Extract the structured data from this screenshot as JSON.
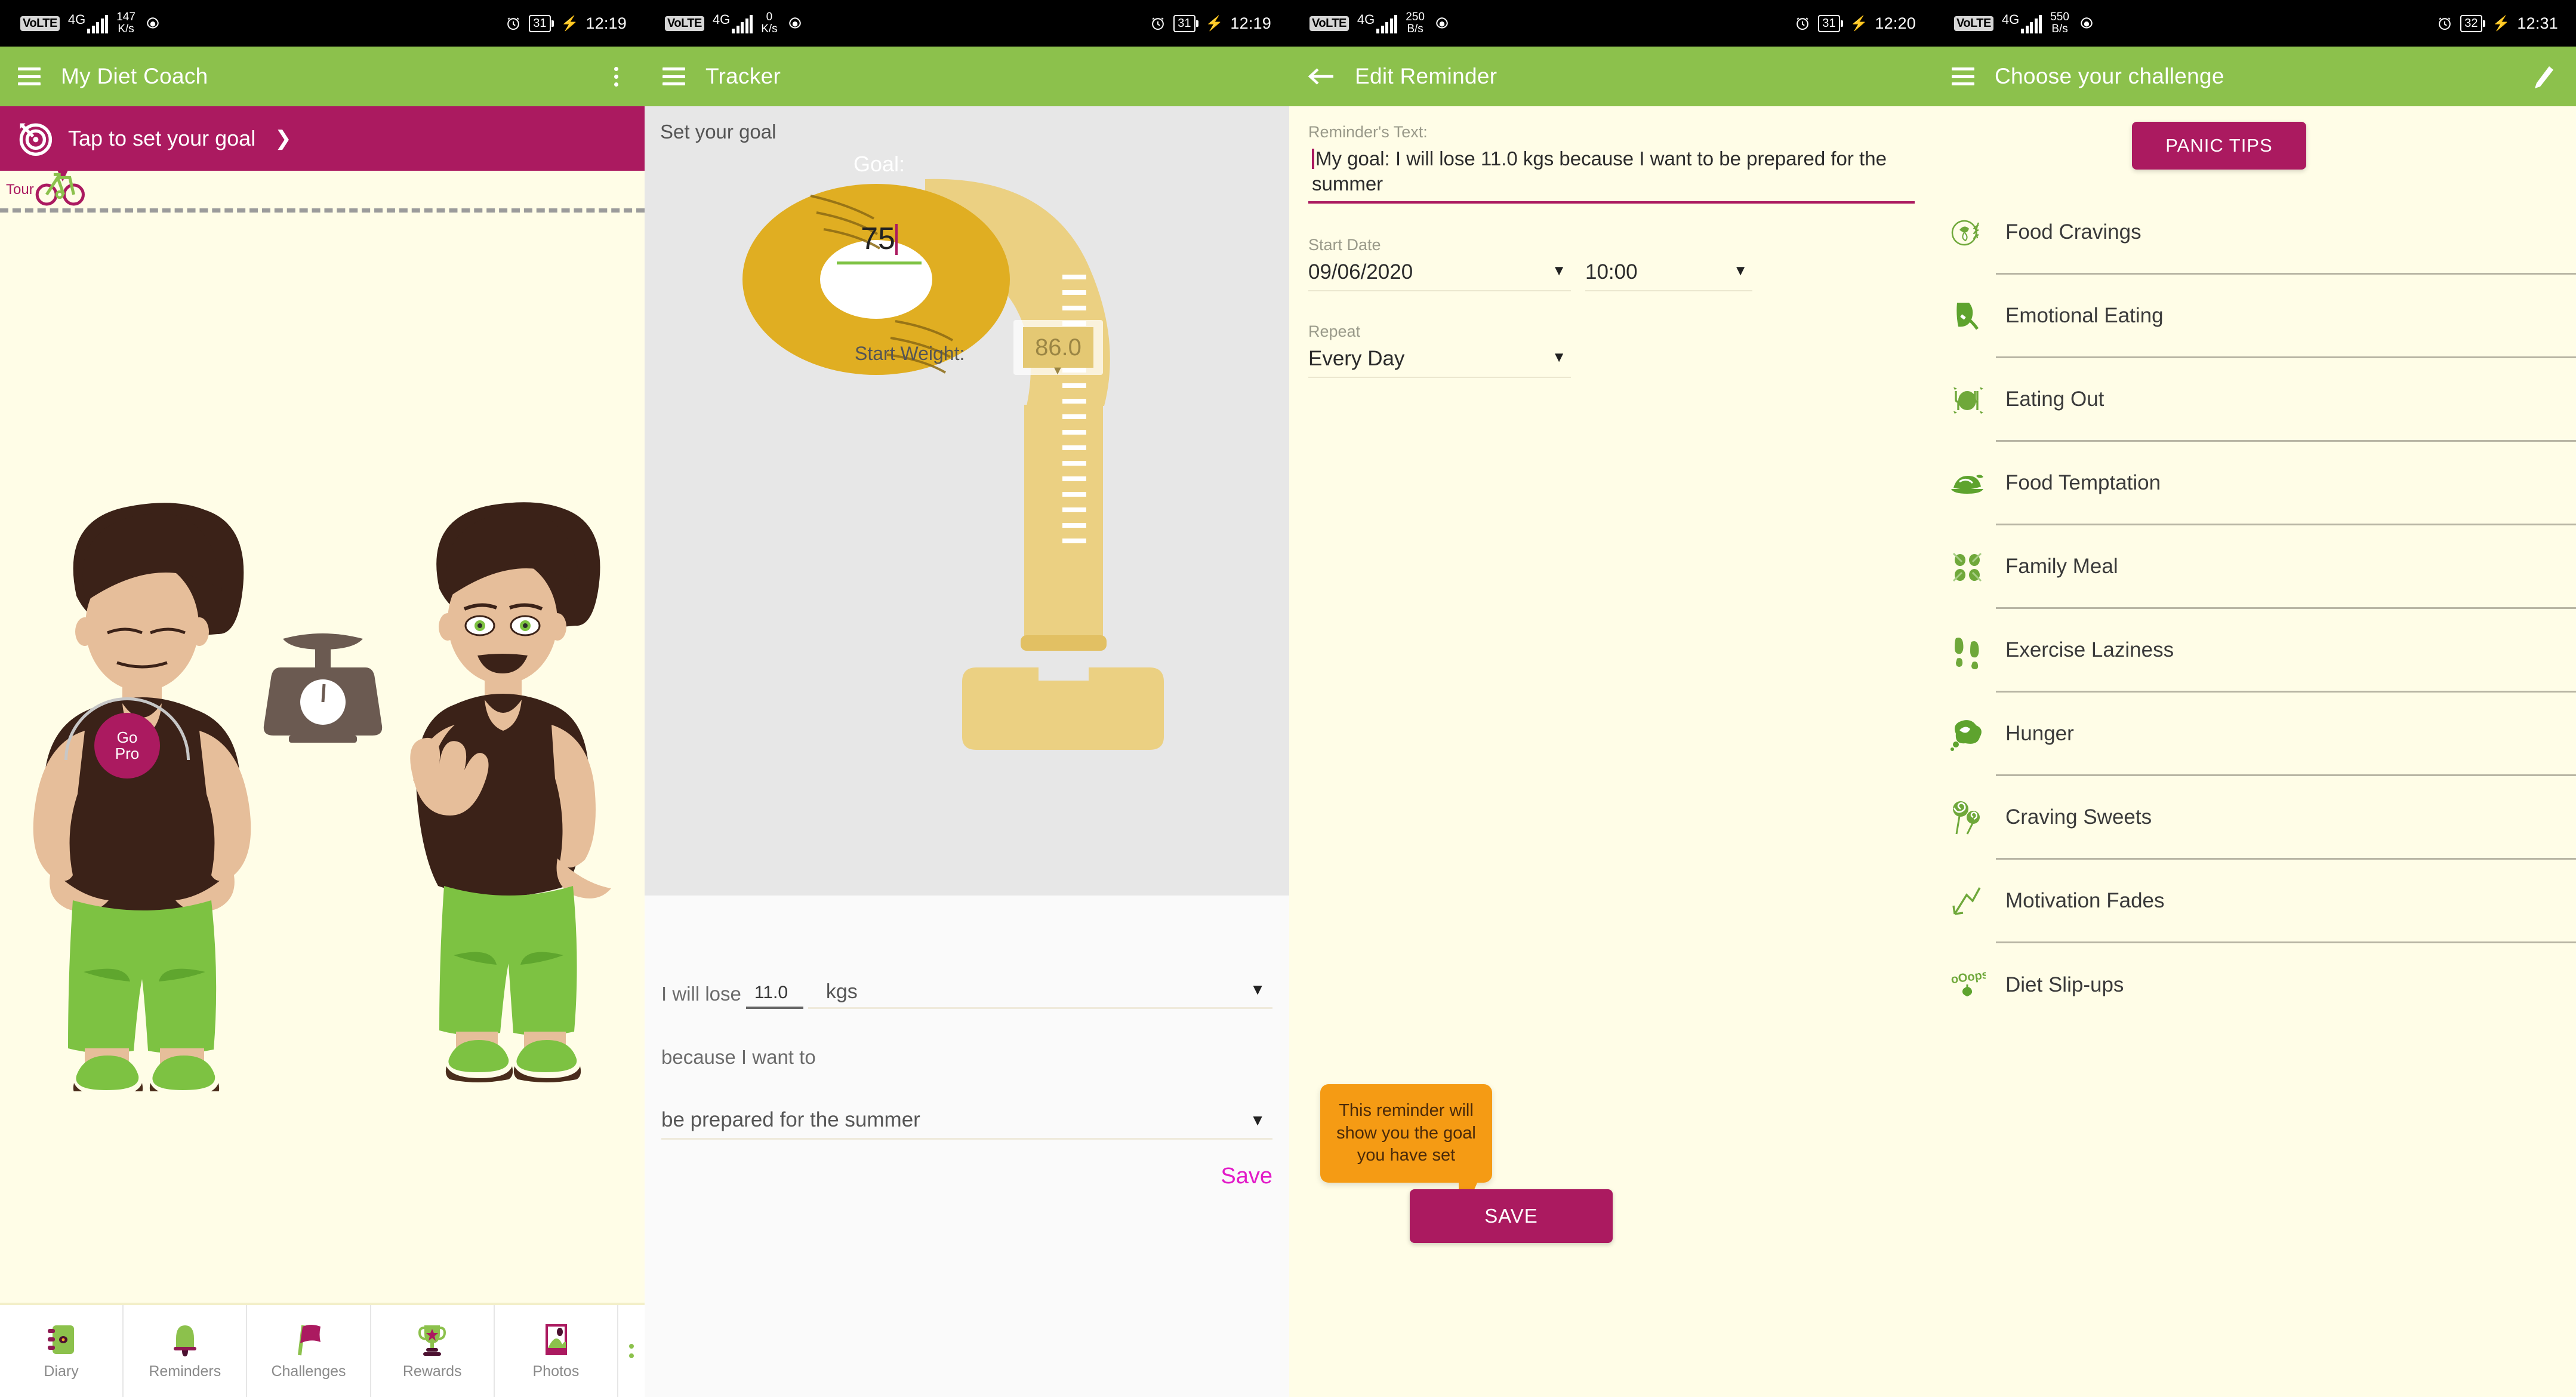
{
  "panels": [
    {
      "status": {
        "volte": "VoLTE",
        "network": "4G",
        "speed_value": "147",
        "speed_unit": "K/s",
        "battery": "31",
        "time": "12:19"
      },
      "appbar": {
        "title": "My Diet Coach",
        "menu_icon": "hamburger-icon",
        "overflow_icon": "kebab-menu-icon"
      },
      "goal_banner": {
        "text": "Tap to set your goal",
        "chevron": "❯",
        "icon": "target-icon"
      },
      "tour": {
        "label": "Tour",
        "icon": "bicycle-icon"
      },
      "go_pro": {
        "line1": "Go",
        "line2": "Pro"
      },
      "bottom_nav": [
        {
          "label": "Diary",
          "icon": "diary-icon"
        },
        {
          "label": "Reminders",
          "icon": "bell-icon"
        },
        {
          "label": "Challenges",
          "icon": "flag-icon"
        },
        {
          "label": "Rewards",
          "icon": "trophy-icon"
        },
        {
          "label": "Photos",
          "icon": "photo-icon"
        }
      ]
    },
    {
      "status": {
        "volte": "VoLTE",
        "network": "4G",
        "speed_value": "0",
        "speed_unit": "K/s",
        "battery": "31",
        "time": "12:19"
      },
      "appbar": {
        "title": "Tracker",
        "menu_icon": "hamburger-icon"
      },
      "section_title": "Set your goal",
      "goal_dial": {
        "label": "Goal:",
        "value": "75"
      },
      "start_weight": {
        "label": "Start Weight:",
        "value": "86.0"
      },
      "form": {
        "prefix": "I will lose",
        "amount": "11.0",
        "unit": "kgs",
        "unit_caret": "▼",
        "reason_prefix": "because I want to",
        "reason": "be prepared for the summer",
        "reason_caret": "▼",
        "save_label": "Save"
      }
    },
    {
      "status": {
        "volte": "VoLTE",
        "network": "4G",
        "speed_value": "250",
        "speed_unit": "B/s",
        "battery": "31",
        "time": "12:20"
      },
      "appbar": {
        "title": "Edit Reminder",
        "back_icon": "back-arrow-icon"
      },
      "form": {
        "reminder_text_label": "Reminder's Text:",
        "reminder_text_value": "My goal: I will lose 11.0 kgs because I want to be prepared for the summer",
        "start_date_label": "Start Date",
        "start_date_value": "09/06/2020",
        "start_time_value": "10:00",
        "repeat_label": "Repeat",
        "repeat_value": "Every Day",
        "caret": "▼"
      },
      "tooltip": "This reminder will show you the goal you have set",
      "save_label": "SAVE"
    },
    {
      "status": {
        "volte": "VoLTE",
        "network": "4G",
        "speed_value": "550",
        "speed_unit": "B/s",
        "battery": "32",
        "time": "12:31"
      },
      "appbar": {
        "title": "Choose your challenge",
        "menu_icon": "hamburger-icon",
        "edit_icon": "pencil-icon"
      },
      "panic_tips_label": "PANIC TIPS",
      "challenges": [
        {
          "label": "Food Cravings",
          "icon": "vegetable-heart-icon"
        },
        {
          "label": "Emotional Eating",
          "icon": "fork-face-icon"
        },
        {
          "label": "Eating Out",
          "icon": "plate-cutlery-icon"
        },
        {
          "label": "Food Temptation",
          "icon": "roast-chicken-icon"
        },
        {
          "label": "Family Meal",
          "icon": "four-plates-icon"
        },
        {
          "label": "Exercise Laziness",
          "icon": "footprints-icon"
        },
        {
          "label": "Hunger",
          "icon": "thought-bubble-chicken-icon"
        },
        {
          "label": "Craving Sweets",
          "icon": "lollipops-icon"
        },
        {
          "label": "Motivation Fades",
          "icon": "downward-chart-icon"
        },
        {
          "label": "Diet Slip-ups",
          "icon": "ooops-icon"
        }
      ]
    }
  ],
  "colors": {
    "brand_green": "#8CC14C",
    "brand_magenta": "#AB1A60",
    "cream": "#FFFDE7",
    "gold": "#E0AE22",
    "gold_light": "#EBD082",
    "gray_panel": "#E7E7E7",
    "tooltip_orange": "#F59B14",
    "save_pink": "#E21BC8"
  }
}
